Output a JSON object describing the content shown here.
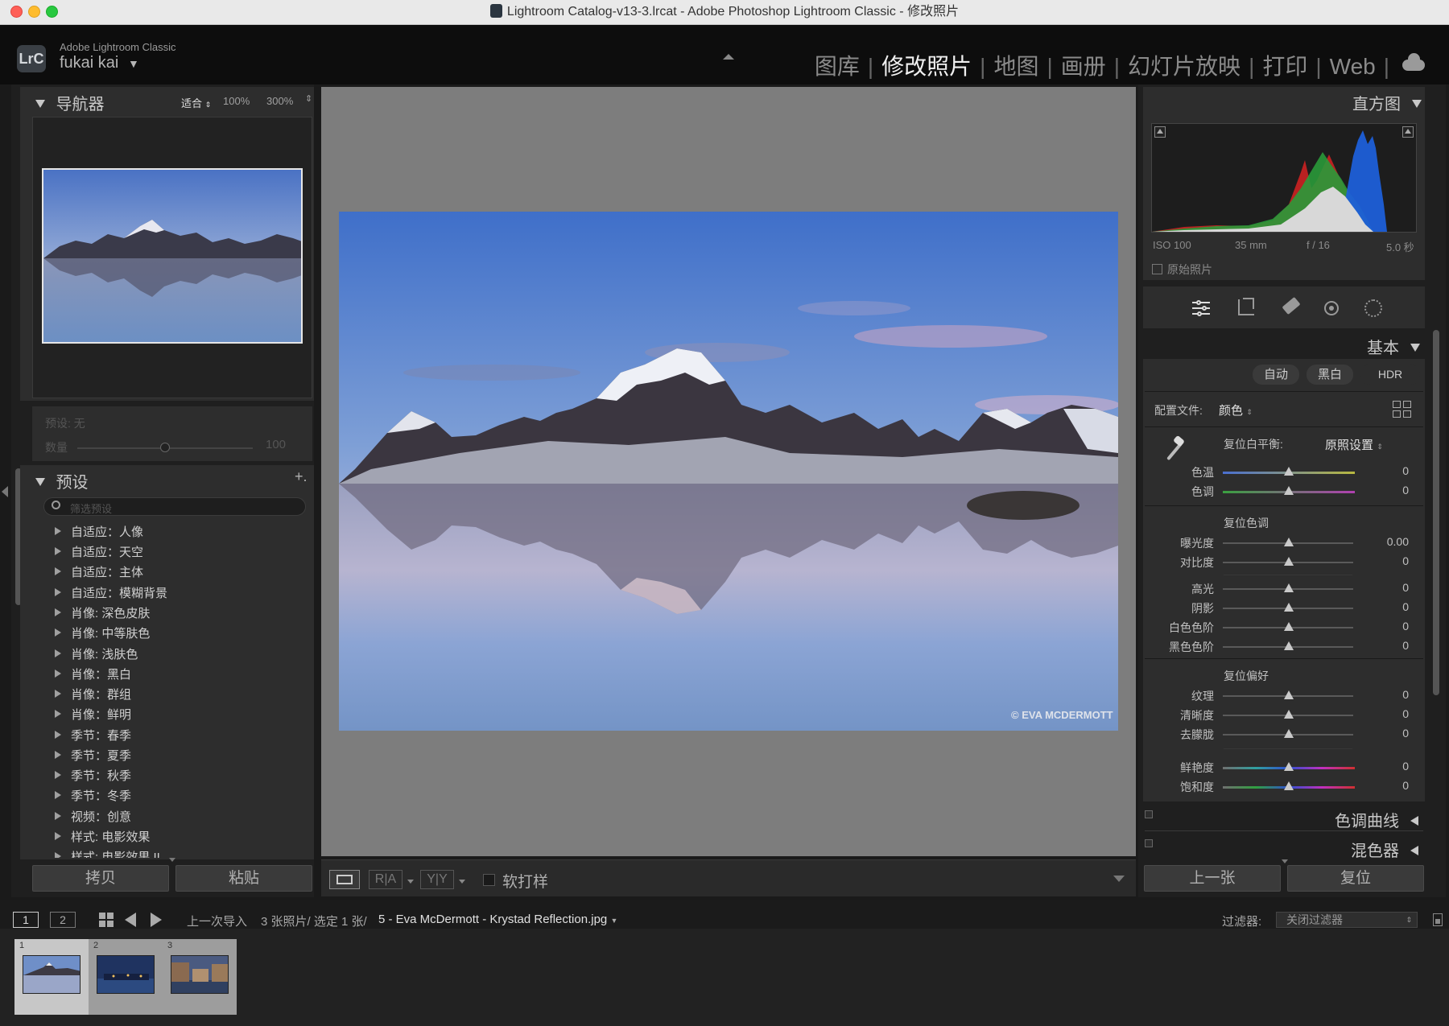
{
  "window": {
    "title": "Lightroom Catalog-v13-3.lrcat - Adobe Photoshop Lightroom Classic - 修改照片"
  },
  "identity": {
    "logo": "LrC",
    "brand": "Adobe Lightroom Classic",
    "user": "fukai kai",
    "modules": [
      "图库",
      "修改照片",
      "地图",
      "画册",
      "幻灯片放映",
      "打印",
      "Web"
    ],
    "active_module": "修改照片",
    "cloud_icon": "cloud-icon"
  },
  "navigator": {
    "title": "导航器",
    "zoom_fit": "适合",
    "zoom_100": "100%",
    "zoom_300": "300%"
  },
  "preset_amount": {
    "preset_label": "预设: 无",
    "amount_label": "数量",
    "amount_value": "100"
  },
  "presets": {
    "title": "预设",
    "add_symbol": "+.",
    "search_placeholder": "筛选预设",
    "items": [
      "自适应：人像",
      "自适应：天空",
      "自适应：主体",
      "自适应：模糊背景",
      "肖像: 深色皮肤",
      "肖像: 中等肤色",
      "肖像: 浅肤色",
      "肖像：黑白",
      "肖像：群组",
      "肖像：鲜明",
      "季节：春季",
      "季节：夏季",
      "季节：秋季",
      "季节：冬季",
      "视频：创意",
      "样式: 电影效果",
      "样式: 电影效果 II"
    ]
  },
  "left_buttons": {
    "copy": "拷贝",
    "paste": "粘贴"
  },
  "photo": {
    "watermark": "© EVA MCDERMOTT",
    "thumb_watermark": "© EVA MCDERMOTT"
  },
  "toolbar": {
    "softproof_label": "软打样",
    "compare_ra": "R|A",
    "compare_yy": "Y|Y"
  },
  "histogram": {
    "title": "直方图",
    "iso": "ISO 100",
    "focal": "35 mm",
    "aperture": "f / 16",
    "shutter": "5.0 秒",
    "original_label": "原始照片"
  },
  "basic": {
    "title": "基本",
    "treatment_buttons": [
      "自动",
      "黑白",
      "HDR"
    ],
    "profile_label": "配置文件:",
    "profile_value": "颜色",
    "wb_label": "复位白平衡:",
    "wb_value": "原照设置",
    "tone_header": "复位色调",
    "presence_header": "复位偏好",
    "sliders": {
      "temp": {
        "label": "色温",
        "value": "0"
      },
      "tint": {
        "label": "色调",
        "value": "0"
      },
      "exposure": {
        "label": "曝光度",
        "value": "0.00"
      },
      "contrast": {
        "label": "对比度",
        "value": "0"
      },
      "highlights": {
        "label": "高光",
        "value": "0"
      },
      "shadows": {
        "label": "阴影",
        "value": "0"
      },
      "whites": {
        "label": "白色色阶",
        "value": "0"
      },
      "blacks": {
        "label": "黑色色阶",
        "value": "0"
      },
      "texture": {
        "label": "纹理",
        "value": "0"
      },
      "clarity": {
        "label": "清晰度",
        "value": "0"
      },
      "dehaze": {
        "label": "去朦胧",
        "value": "0"
      },
      "vibrance": {
        "label": "鲜艳度",
        "value": "0"
      },
      "saturation": {
        "label": "饱和度",
        "value": "0"
      }
    }
  },
  "collapsed_panels": {
    "tone_curve": "色调曲线",
    "mixer": "混色器"
  },
  "right_buttons": {
    "previous": "上一张",
    "reset": "复位"
  },
  "filmbar": {
    "view1": "1",
    "view2": "2",
    "source": "上一次导入",
    "count": "3 张照片/ 选定 1 张/",
    "filename": "5 - Eva McDermott - Krystad Reflection.jpg",
    "filter_label": "过滤器:",
    "filter_value": "关闭过滤器"
  },
  "filmstrip": {
    "cells": [
      "1",
      "2",
      "3"
    ]
  }
}
